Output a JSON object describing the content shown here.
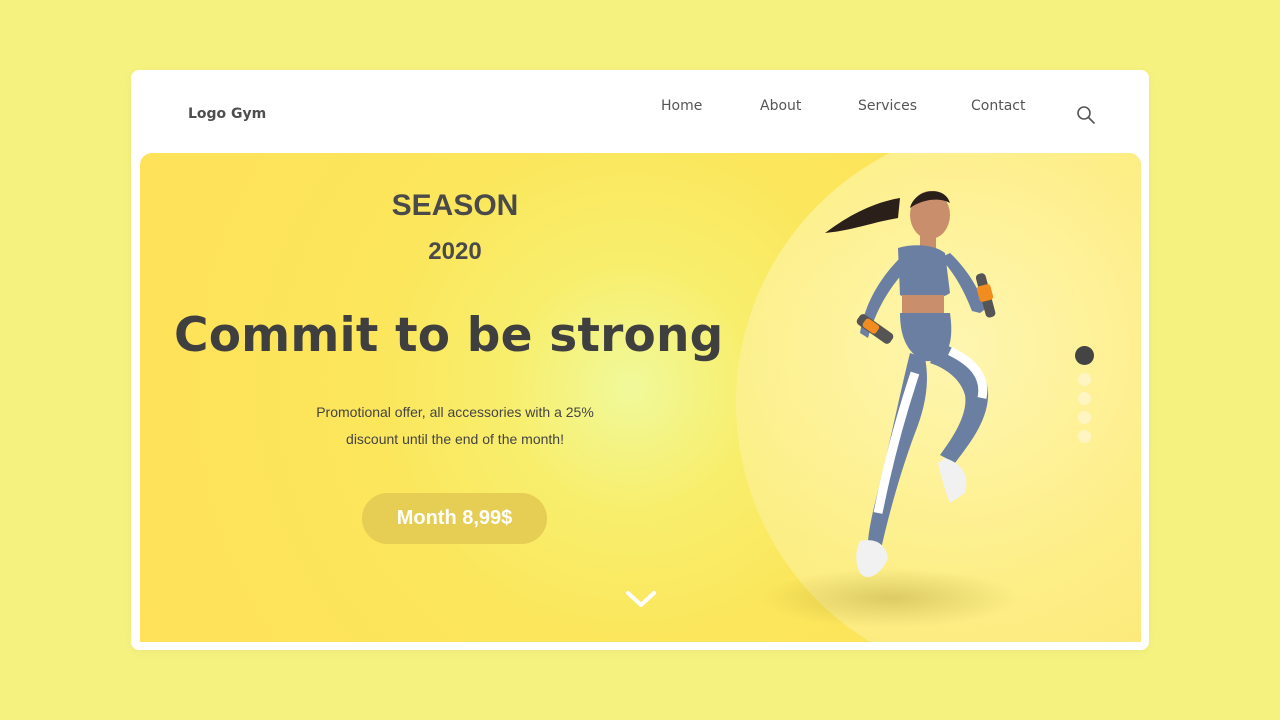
{
  "header": {
    "logo": "Logo Gym",
    "nav": [
      "Home",
      "About",
      "Services",
      "Contact"
    ],
    "search_icon": "search-icon"
  },
  "hero": {
    "season": "SEASON",
    "year": "2020",
    "headline": "Commit to be strong",
    "promo_line1": "Promotional offer, all accessories with a 25%",
    "promo_line2": "discount until the end of the month!",
    "cta_label": "Month 8,99$",
    "scroll_icon": "chevron-down-icon",
    "slider_dots": 5,
    "active_dot": 1
  },
  "colors": {
    "page_bg": "#f5f27f",
    "hero_accent": "#fde45a",
    "cta_bg": "#e6cd53",
    "text_dark": "#3f3f3f"
  }
}
